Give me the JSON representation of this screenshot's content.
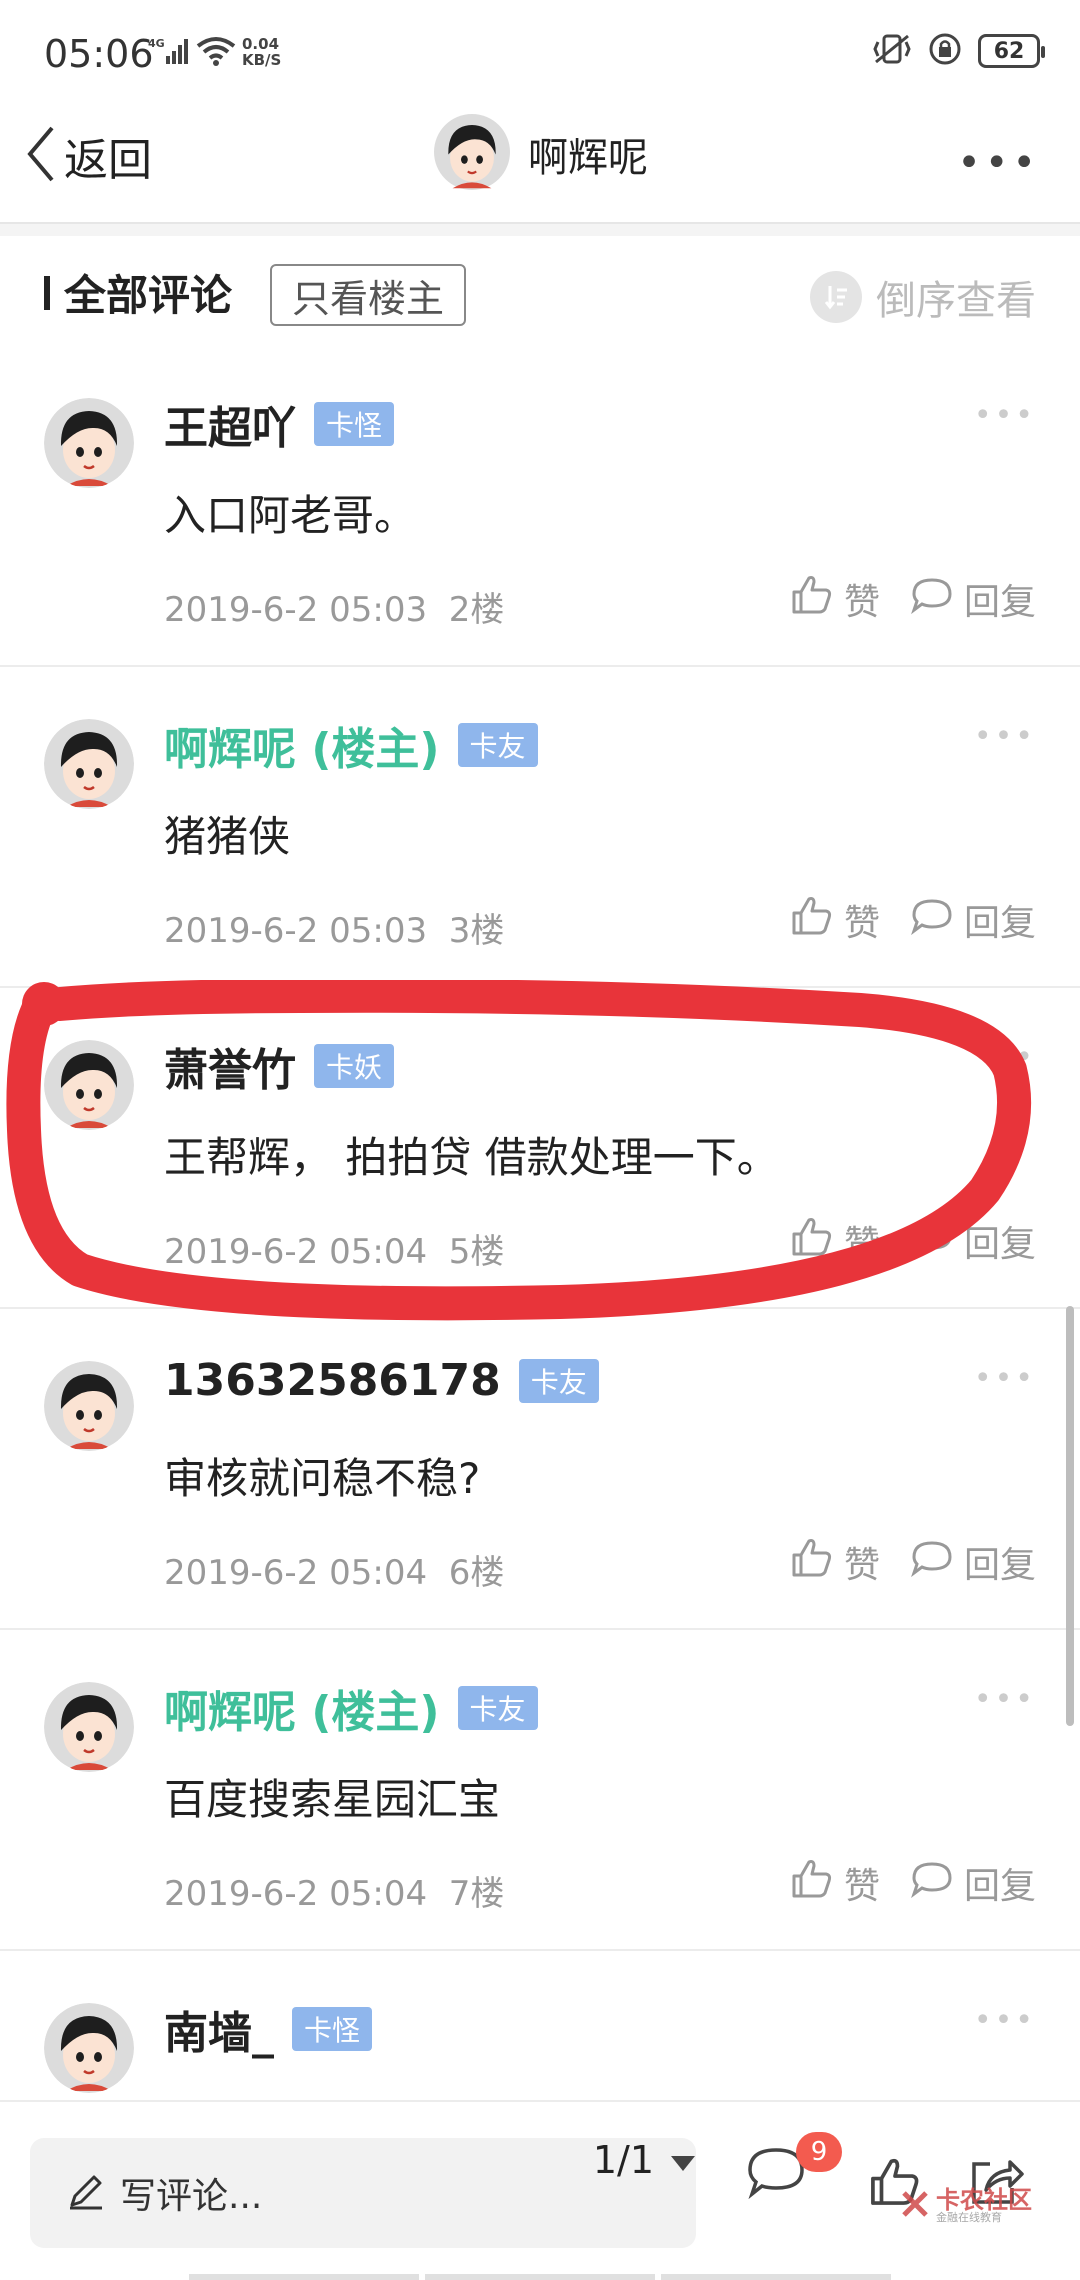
{
  "status_bar": {
    "time": "05:06",
    "network": "4G",
    "speed_value": "0.04",
    "speed_unit": "KB/S",
    "battery": "62"
  },
  "header": {
    "back_label": "返回",
    "title": "啊辉呢"
  },
  "filter": {
    "all_comments": "全部评论",
    "only_op": "只看楼主",
    "reverse": "倒序查看"
  },
  "comments": [
    {
      "user": "王超吖",
      "op": false,
      "tag": "卡怪",
      "text": "入口阿老哥。",
      "date": "2019-6-2 05:03",
      "floor": "2楼",
      "like": "赞",
      "reply": "回复"
    },
    {
      "user": "啊辉呢 (楼主)",
      "op": true,
      "tag": "卡友",
      "text": "猪猪侠",
      "date": "2019-6-2 05:03",
      "floor": "3楼",
      "like": "赞",
      "reply": "回复"
    },
    {
      "user": "萧誉竹",
      "op": false,
      "tag": "卡妖",
      "text": "王帮辉， 拍拍贷 借款处理一下。",
      "date": "2019-6-2 05:04",
      "floor": "5楼",
      "like": "赞",
      "reply": "回复"
    },
    {
      "user": "13632586178",
      "op": false,
      "tag": "卡友",
      "text": "审核就问稳不稳?",
      "date": "2019-6-2 05:04",
      "floor": "6楼",
      "like": "赞",
      "reply": "回复"
    },
    {
      "user": "啊辉呢 (楼主)",
      "op": true,
      "tag": "卡友",
      "text": "百度搜索星园汇宝",
      "date": "2019-6-2 05:04",
      "floor": "7楼",
      "like": "赞",
      "reply": "回复"
    },
    {
      "user": "南墙_",
      "op": false,
      "tag": "卡怪",
      "text": "",
      "date": "",
      "floor": "",
      "like": "",
      "reply": ""
    }
  ],
  "bottom": {
    "write_placeholder": "写评论...",
    "page": "1/1",
    "comment_badge": "9",
    "watermark": "卡农社区",
    "watermark_sub": "金融在线教育"
  },
  "colors": {
    "op_name": "#3fbf9a",
    "tag_bg": "#8fb6ec",
    "annotation_red": "#e8343a",
    "badge_red": "#f35b4f"
  }
}
